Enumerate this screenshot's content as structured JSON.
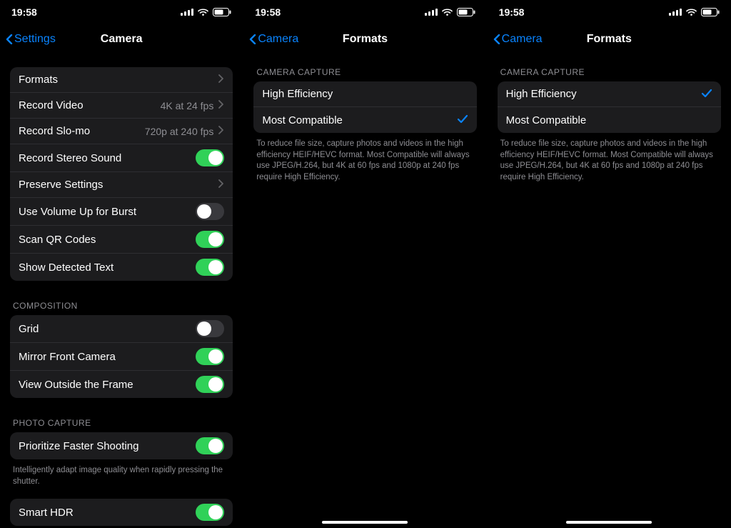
{
  "statusbar": {
    "time": "19:58"
  },
  "screen1": {
    "back": "Settings",
    "title": "Camera",
    "group_a": {
      "formats": "Formats",
      "record_video": "Record Video",
      "record_video_detail": "4K at 24 fps",
      "record_slomo": "Record Slo-mo",
      "record_slomo_detail": "720p at 240 fps",
      "stereo": "Record Stereo Sound",
      "preserve": "Preserve Settings",
      "volume_burst": "Use Volume Up for Burst",
      "scan_qr": "Scan QR Codes",
      "detected_text": "Show Detected Text"
    },
    "composition": {
      "header": "COMPOSITION",
      "grid": "Grid",
      "mirror": "Mirror Front Camera",
      "outside_frame": "View Outside the Frame"
    },
    "photo_capture": {
      "header": "PHOTO CAPTURE",
      "prioritize": "Prioritize Faster Shooting",
      "prioritize_footer": "Intelligently adapt image quality when rapidly pressing the shutter.",
      "smart_hdr": "Smart HDR"
    }
  },
  "screen2": {
    "back": "Camera",
    "title": "Formats",
    "header": "CAMERA CAPTURE",
    "high_efficiency": "High Efficiency",
    "most_compatible": "Most Compatible",
    "selected": "most_compatible",
    "footer": "To reduce file size, capture photos and videos in the high efficiency HEIF/HEVC format. Most Compatible will always use JPEG/H.264, but 4K at 60 fps and 1080p at 240 fps require High Efficiency."
  },
  "screen3": {
    "back": "Camera",
    "title": "Formats",
    "header": "CAMERA CAPTURE",
    "high_efficiency": "High Efficiency",
    "most_compatible": "Most Compatible",
    "selected": "high_efficiency",
    "footer": "To reduce file size, capture photos and videos in the high efficiency HEIF/HEVC format. Most Compatible will always use JPEG/H.264, but 4K at 60 fps and 1080p at 240 fps require High Efficiency."
  }
}
